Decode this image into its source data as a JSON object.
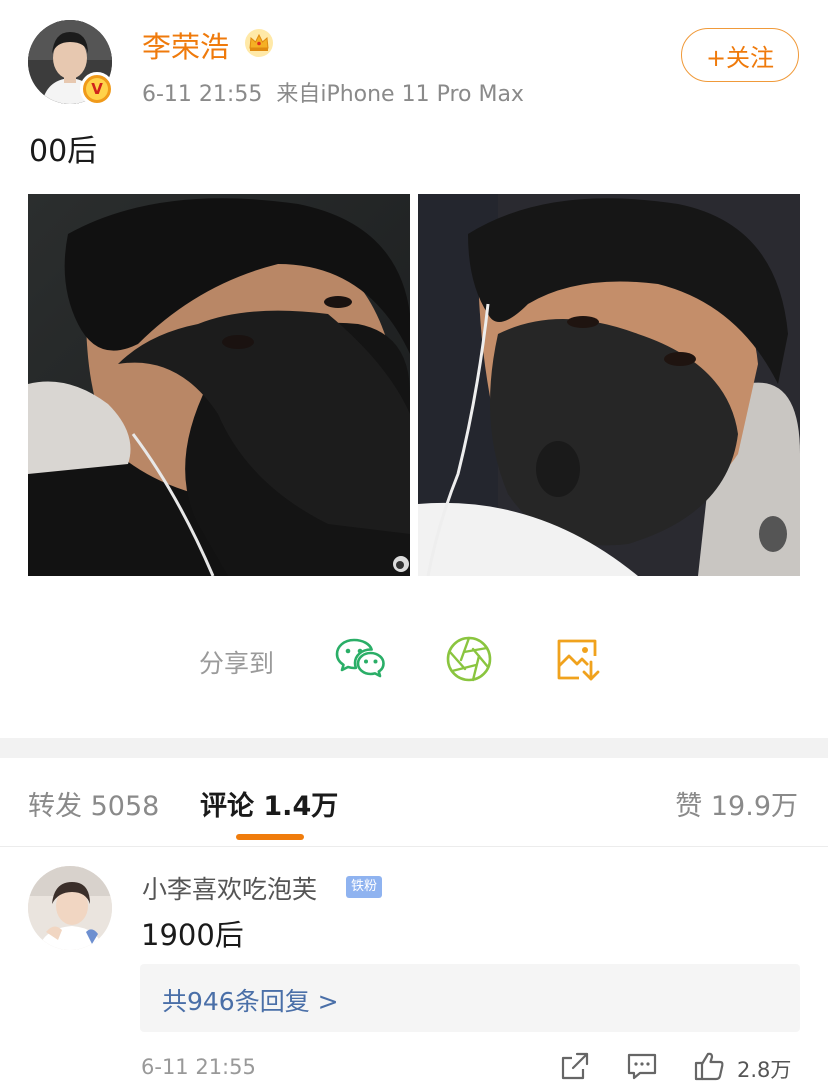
{
  "post": {
    "username": "李荣浩",
    "time": "6-11 21:55",
    "source": "来自iPhone 11 Pro Max",
    "follow_label": "+关注",
    "text": "00后",
    "verified_badge": "V",
    "crown_icon": "crown-icon",
    "images": [
      {
        "name": "selfie-masked-dark",
        "description": "man wearing black mask with earphones"
      },
      {
        "name": "selfie-masked-light",
        "description": "man wearing black mask with earphones"
      }
    ],
    "watermark_icon": "weibo-watermark-icon"
  },
  "share": {
    "label": "分享到",
    "targets": [
      {
        "icon": "wechat-icon",
        "color": "#2aae67"
      },
      {
        "icon": "moments-icon",
        "color": "#8ac53f"
      },
      {
        "icon": "save-image-icon",
        "color": "#f0a21d"
      }
    ]
  },
  "tabs": {
    "repost": "转发 5058",
    "comment": "评论 1.4万",
    "like": "赞 19.9万",
    "active": "comment",
    "accent": "#f07c0c"
  },
  "comment": {
    "username": "小李喜欢吃泡芙",
    "badge": "铁粉",
    "text": "1900后",
    "replies_link": "共946条回复 >",
    "time": "6-11 21:55",
    "like_count": "2.8万"
  },
  "colors": {
    "brand_orange": "#ef7a0b",
    "link_blue": "#4a6fa8",
    "fan_badge": "#8fb3f0"
  }
}
